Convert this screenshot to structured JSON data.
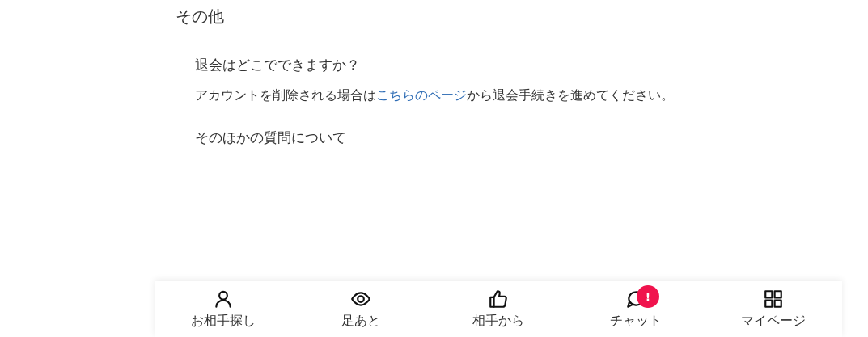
{
  "section_title": "その他",
  "faq": [
    {
      "question": "退会はどこでできますか？",
      "answer": {
        "before": "アカウントを削除される場合は",
        "link": "こちらのページ",
        "after": "から退会手続きを進めてください。"
      }
    },
    {
      "question": "そのほかの質問について"
    }
  ],
  "bottom_nav": [
    {
      "kind": "person",
      "label": "お相手探し"
    },
    {
      "kind": "eye",
      "label": "足あと"
    },
    {
      "kind": "thumb",
      "label": "相手から"
    },
    {
      "kind": "chat",
      "label": "チャット",
      "badge": "!"
    },
    {
      "kind": "grid",
      "label": "マイページ"
    }
  ]
}
